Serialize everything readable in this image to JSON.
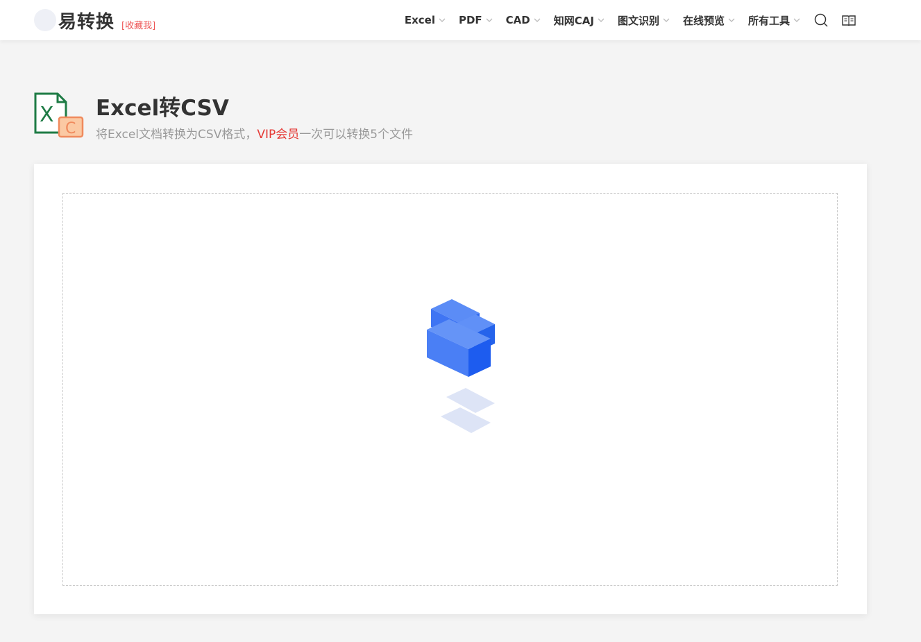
{
  "header": {
    "logo_text": "易转换",
    "bookmark_label": "[收藏我]",
    "nav": [
      {
        "label": "Excel"
      },
      {
        "label": "PDF"
      },
      {
        "label": "CAD"
      },
      {
        "label": "知网CAJ"
      },
      {
        "label": "图文识别"
      },
      {
        "label": "在线预览"
      },
      {
        "label": "所有工具"
      }
    ]
  },
  "tool": {
    "title": "Excel转CSV",
    "desc_prefix": "将Excel文档转换为CSV格式，",
    "desc_vip": "VIP会员",
    "desc_suffix": "一次可以转换5个文件",
    "icon_letter_x": "X",
    "icon_letter_c": "C"
  },
  "colors": {
    "accent": "#3b82f6",
    "vip": "#e53935",
    "excel_green": "#1e7b45",
    "csv_orange": "#f08a5d"
  }
}
